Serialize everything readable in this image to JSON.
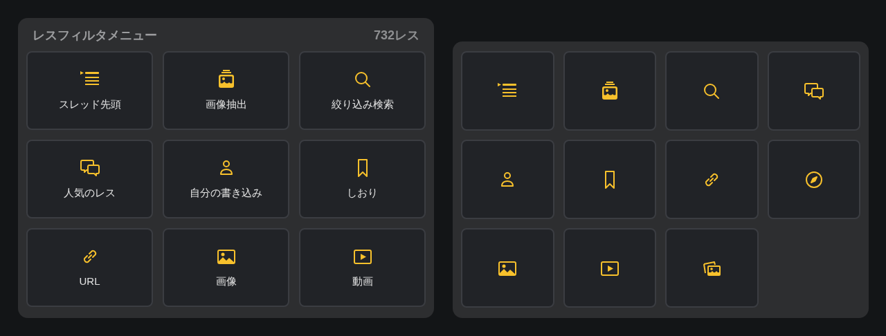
{
  "filter_menu": {
    "title": "レスフィルタメニュー",
    "count": "732レス",
    "items": [
      {
        "kind": "thread-top",
        "label": "スレッド先頭"
      },
      {
        "kind": "image-stack",
        "label": "画像抽出"
      },
      {
        "kind": "search",
        "label": "絞り込み検索"
      },
      {
        "kind": "chat",
        "label": "人気のレス"
      },
      {
        "kind": "person",
        "label": "自分の書き込み"
      },
      {
        "kind": "bookmark",
        "label": "しおり"
      },
      {
        "kind": "link",
        "label": "URL"
      },
      {
        "kind": "image",
        "label": "画像"
      },
      {
        "kind": "video",
        "label": "動画"
      }
    ]
  },
  "icon_grid": {
    "items": [
      {
        "kind": "thread-top"
      },
      {
        "kind": "image-stack"
      },
      {
        "kind": "search"
      },
      {
        "kind": "chat"
      },
      {
        "kind": "person"
      },
      {
        "kind": "bookmark"
      },
      {
        "kind": "link"
      },
      {
        "kind": "compass"
      },
      {
        "kind": "image"
      },
      {
        "kind": "video"
      },
      {
        "kind": "photos"
      }
    ]
  }
}
